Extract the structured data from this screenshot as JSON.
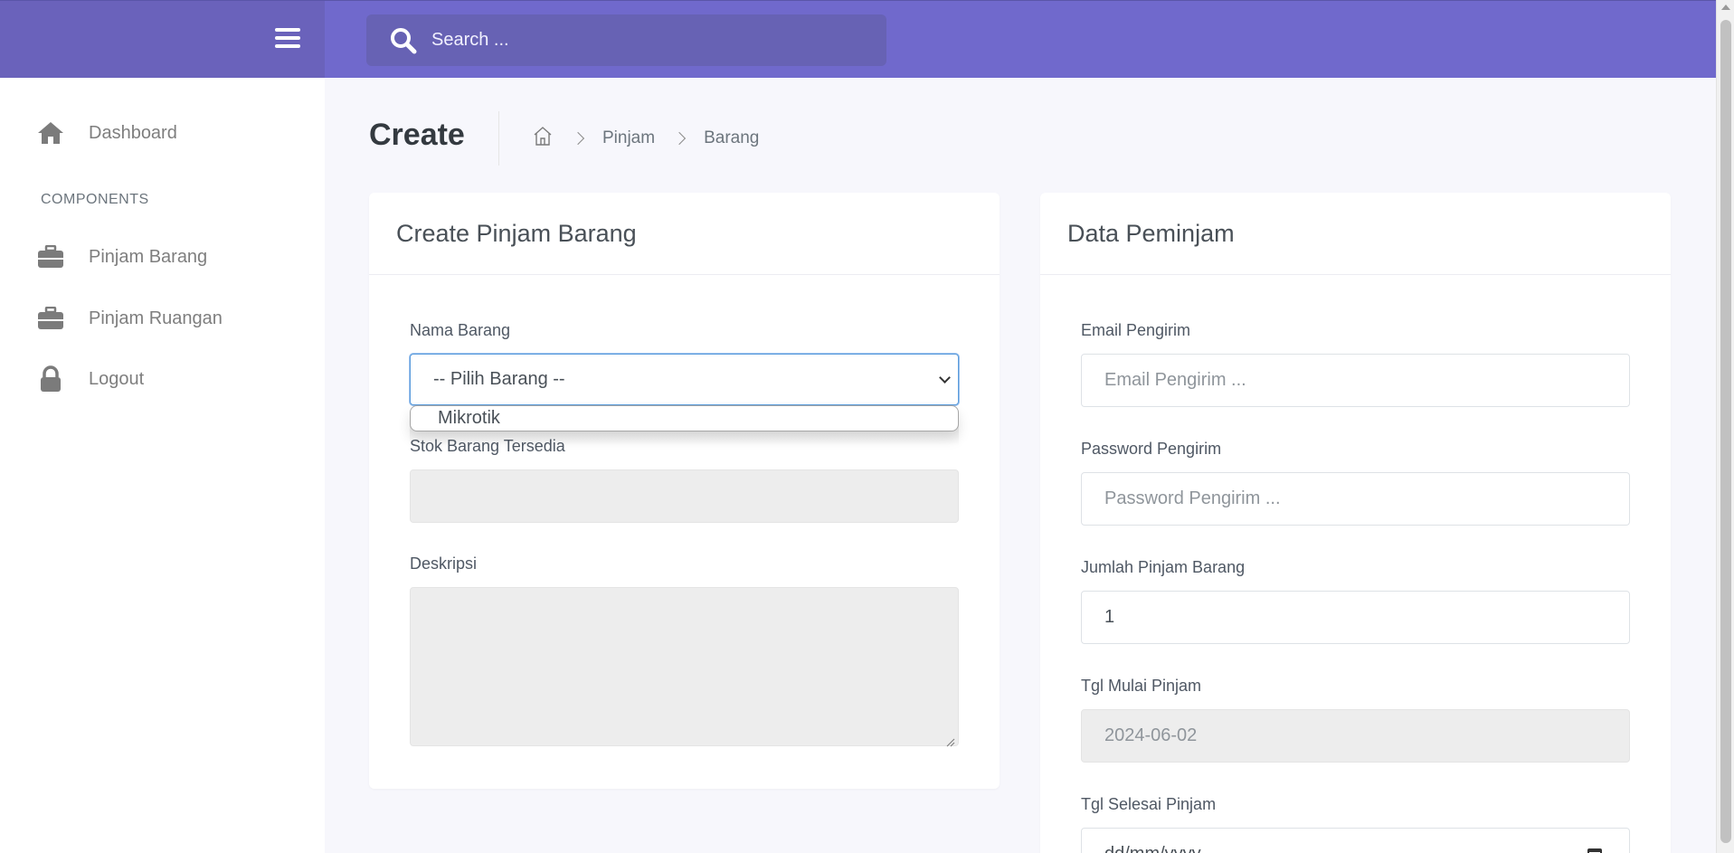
{
  "topbar": {
    "search_placeholder": "Search ...",
    "colors": {
      "bar": "#7069cc",
      "brand": "#6a62bb",
      "search_bg": "#6762b4"
    }
  },
  "sidebar": {
    "items": [
      {
        "label": "Dashboard",
        "icon": "home-icon"
      },
      {
        "label": "Pinjam Barang",
        "icon": "briefcase-icon"
      },
      {
        "label": "Pinjam Ruangan",
        "icon": "briefcase-icon"
      },
      {
        "label": "Logout",
        "icon": "lock-icon"
      }
    ],
    "section_label": "COMPONENTS"
  },
  "page": {
    "title": "Create",
    "breadcrumb": {
      "home_icon": "home-outline-icon",
      "items": [
        "Pinjam",
        "Barang"
      ]
    }
  },
  "form_left": {
    "title": "Create Pinjam Barang",
    "nama_barang_label": "Nama Barang",
    "nama_barang_selected": "-- Pilih Barang --",
    "dropdown_options": [
      "Mikrotik"
    ],
    "stok_label": "Stok Barang Tersedia",
    "stok_value": "",
    "deskripsi_label": "Deskripsi",
    "deskripsi_value": ""
  },
  "form_right": {
    "title": "Data Peminjam",
    "email_label": "Email Pengirim",
    "email_placeholder": "Email Pengirim ...",
    "password_label": "Password Pengirim",
    "password_placeholder": "Password Pengirim ...",
    "jumlah_label": "Jumlah Pinjam Barang",
    "jumlah_value": "1",
    "tgl_mulai_label": "Tgl Mulai Pinjam",
    "tgl_mulai_value": "2024-06-02",
    "tgl_selesai_label": "Tgl Selesai Pinjam",
    "tgl_selesai_placeholder": "dd/mm/yyyy"
  }
}
